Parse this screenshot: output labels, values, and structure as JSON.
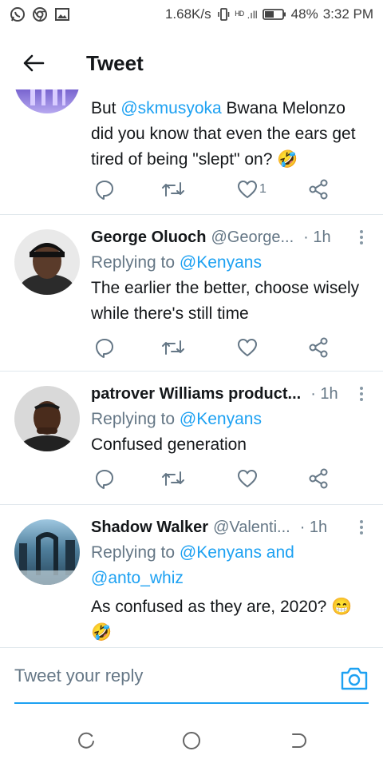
{
  "status_bar": {
    "net_speed": "1.68K/s",
    "signal": "ᴴᴰ .ıll",
    "battery": "48%",
    "time": "3:32 PM"
  },
  "header": {
    "title": "Tweet"
  },
  "tweets": [
    {
      "text_parts": [
        "But ",
        "@skmusyoka",
        "  Bwana Melonzo did you know that even the ears get tired of being \"slept\" on? ",
        "🤣"
      ],
      "like_count": "1"
    },
    {
      "name": "George Oluoch",
      "handle": "@George...",
      "time": "· 1h",
      "replying_prefix": "Replying to ",
      "replying_to": "@Kenyans",
      "text": "The earlier the better, choose wisely while there's still time"
    },
    {
      "name": "patrover Williams product...",
      "handle": "",
      "time": "· 1h",
      "replying_prefix": "Replying to ",
      "replying_to": "@Kenyans",
      "text": "Confused generation"
    },
    {
      "name": "Shadow Walker",
      "handle": "@Valenti...",
      "time": "· 1h",
      "replying_prefix": "Replying to ",
      "replying_to": "@Kenyans and",
      "replying_to_2": "@anto_whiz",
      "text": "As confused as they are, 2020? 😁",
      "text_emoji": "🤣"
    }
  ],
  "composer": {
    "placeholder": "Tweet your reply"
  },
  "colors": {
    "accent": "#1da1f2",
    "muted": "#657786",
    "divider": "#e1e8ed"
  },
  "icons": [
    "back-arrow-icon",
    "reply-icon",
    "retweet-icon",
    "like-icon",
    "share-icon",
    "more-icon",
    "camera-icon",
    "nav-recent-icon",
    "nav-home-icon",
    "nav-back-icon"
  ]
}
